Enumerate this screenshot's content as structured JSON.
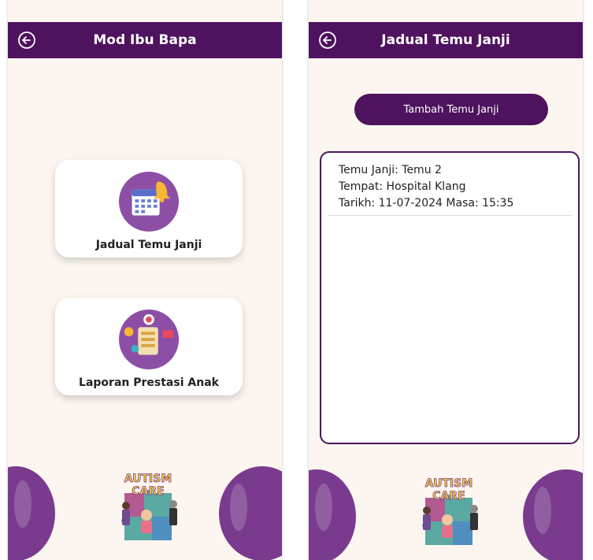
{
  "left_screen": {
    "title": "Mod Ibu Bapa",
    "menu": [
      {
        "label": "Jadual Temu Janji",
        "icon": "calendar-bell-icon"
      },
      {
        "label": "Laporan Prestasi Anak",
        "icon": "report-target-icon"
      }
    ]
  },
  "right_screen": {
    "title": "Jadual Temu Janji",
    "add_button": "Tambah Temu Janji",
    "appointments": [
      {
        "line1": "Temu Janji: Temu 2",
        "line2": "Tempat: Hospital Klang",
        "line3": "Tarikh: 11-07-2024 Masa: 15:35"
      }
    ]
  },
  "logo_text": [
    "AUTISM",
    "CARE"
  ],
  "colors": {
    "primary": "#4e125e",
    "background": "#fdf6f0",
    "accent": "#7a3b8e"
  }
}
